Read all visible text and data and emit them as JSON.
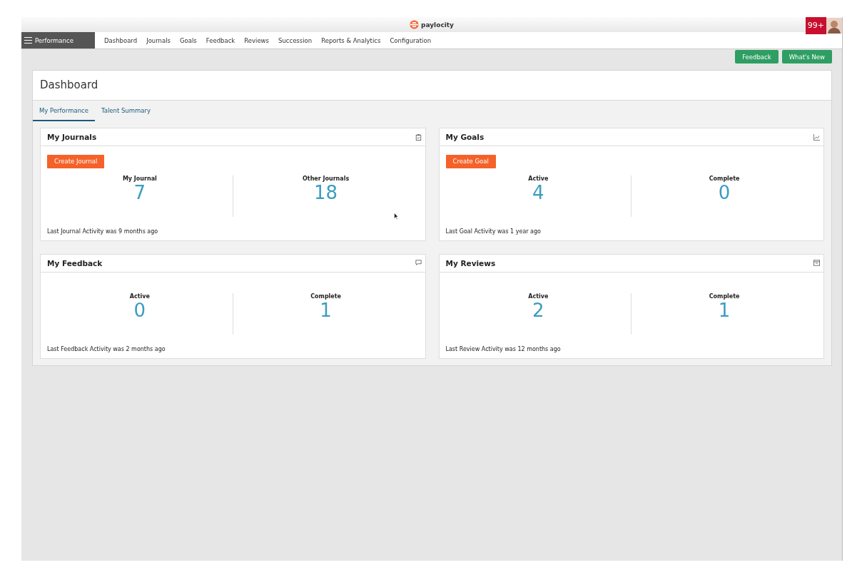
{
  "header": {
    "logo_text": "paylocity",
    "notification_count": "99+"
  },
  "module_menu": {
    "label": "Performance"
  },
  "nav": [
    {
      "label": "Dashboard"
    },
    {
      "label": "Journals"
    },
    {
      "label": "Goals"
    },
    {
      "label": "Feedback"
    },
    {
      "label": "Reviews"
    },
    {
      "label": "Succession"
    },
    {
      "label": "Reports & Analytics"
    },
    {
      "label": "Configuration"
    }
  ],
  "actions": [
    "Feedback",
    "What's New"
  ],
  "page": {
    "title": "Dashboard"
  },
  "tabs": [
    {
      "label": "My Performance",
      "selected": true
    },
    {
      "label": "Talent Summary",
      "selected": false
    }
  ],
  "cards": [
    {
      "title": "My Journals",
      "button": "Create Journal",
      "stats": [
        {
          "label": "My Journal",
          "value": "7"
        },
        {
          "label": "Other Journals",
          "value": "18"
        }
      ],
      "footer": "Last Journal Activity was 9 months ago"
    },
    {
      "title": "My Goals",
      "button": "Create Goal",
      "stats": [
        {
          "label": "Active",
          "value": "4"
        },
        {
          "label": "Complete",
          "value": "0"
        }
      ],
      "footer": "Last Goal Activity was 1 year ago"
    },
    {
      "title": "My Feedback",
      "stats": [
        {
          "label": "Active",
          "value": "0"
        },
        {
          "label": "Complete",
          "value": "1"
        }
      ],
      "footer": "Last Feedback Activity was 2 months ago"
    },
    {
      "title": "My Reviews",
      "stats": [
        {
          "label": "Active",
          "value": "2"
        },
        {
          "label": "Complete",
          "value": "1"
        }
      ],
      "footer": "Last Review Activity was 12 months ago"
    }
  ]
}
